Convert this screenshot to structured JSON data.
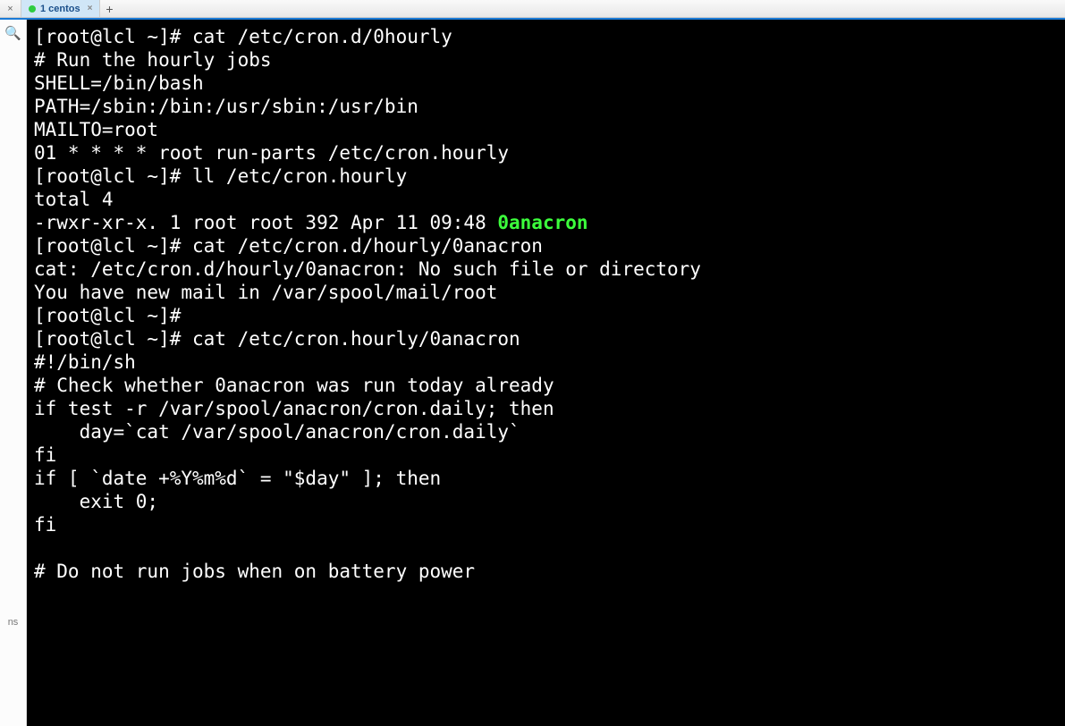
{
  "tabbar": {
    "close_left": "×",
    "tab1_label": "1 centos",
    "tab1_close": "×",
    "add": "+"
  },
  "gutter": {
    "search_glyph": "🔍",
    "ns_label": "ns"
  },
  "term": {
    "lines": {
      "l0": "[root@lcl ~]# cat /etc/cron.d/0hourly",
      "l1": "# Run the hourly jobs",
      "l2": "SHELL=/bin/bash",
      "l3": "PATH=/sbin:/bin:/usr/sbin:/usr/bin",
      "l4": "MAILTO=root",
      "l5": "01 * * * * root run-parts /etc/cron.hourly",
      "l6": "[root@lcl ~]# ll /etc/cron.hourly",
      "l7": "total 4",
      "l8a": "-rwxr-xr-x. 1 root root 392 Apr 11 09:48 ",
      "l8b": "0anacron",
      "l9": "[root@lcl ~]# cat /etc/cron.d/hourly/0anacron",
      "l10": "cat: /etc/cron.d/hourly/0anacron: No such file or directory",
      "l11": "You have new mail in /var/spool/mail/root",
      "l12": "[root@lcl ~]# ",
      "l13": "[root@lcl ~]# cat /etc/cron.hourly/0anacron",
      "l14": "#!/bin/sh",
      "l15": "# Check whether 0anacron was run today already",
      "l16": "if test -r /var/spool/anacron/cron.daily; then",
      "l17": "    day=`cat /var/spool/anacron/cron.daily`",
      "l18": "fi",
      "l19": "if [ `date +%Y%m%d` = \"$day\" ]; then",
      "l20": "    exit 0;",
      "l21": "fi",
      "l22": "",
      "l23": "# Do not run jobs when on battery power"
    }
  }
}
